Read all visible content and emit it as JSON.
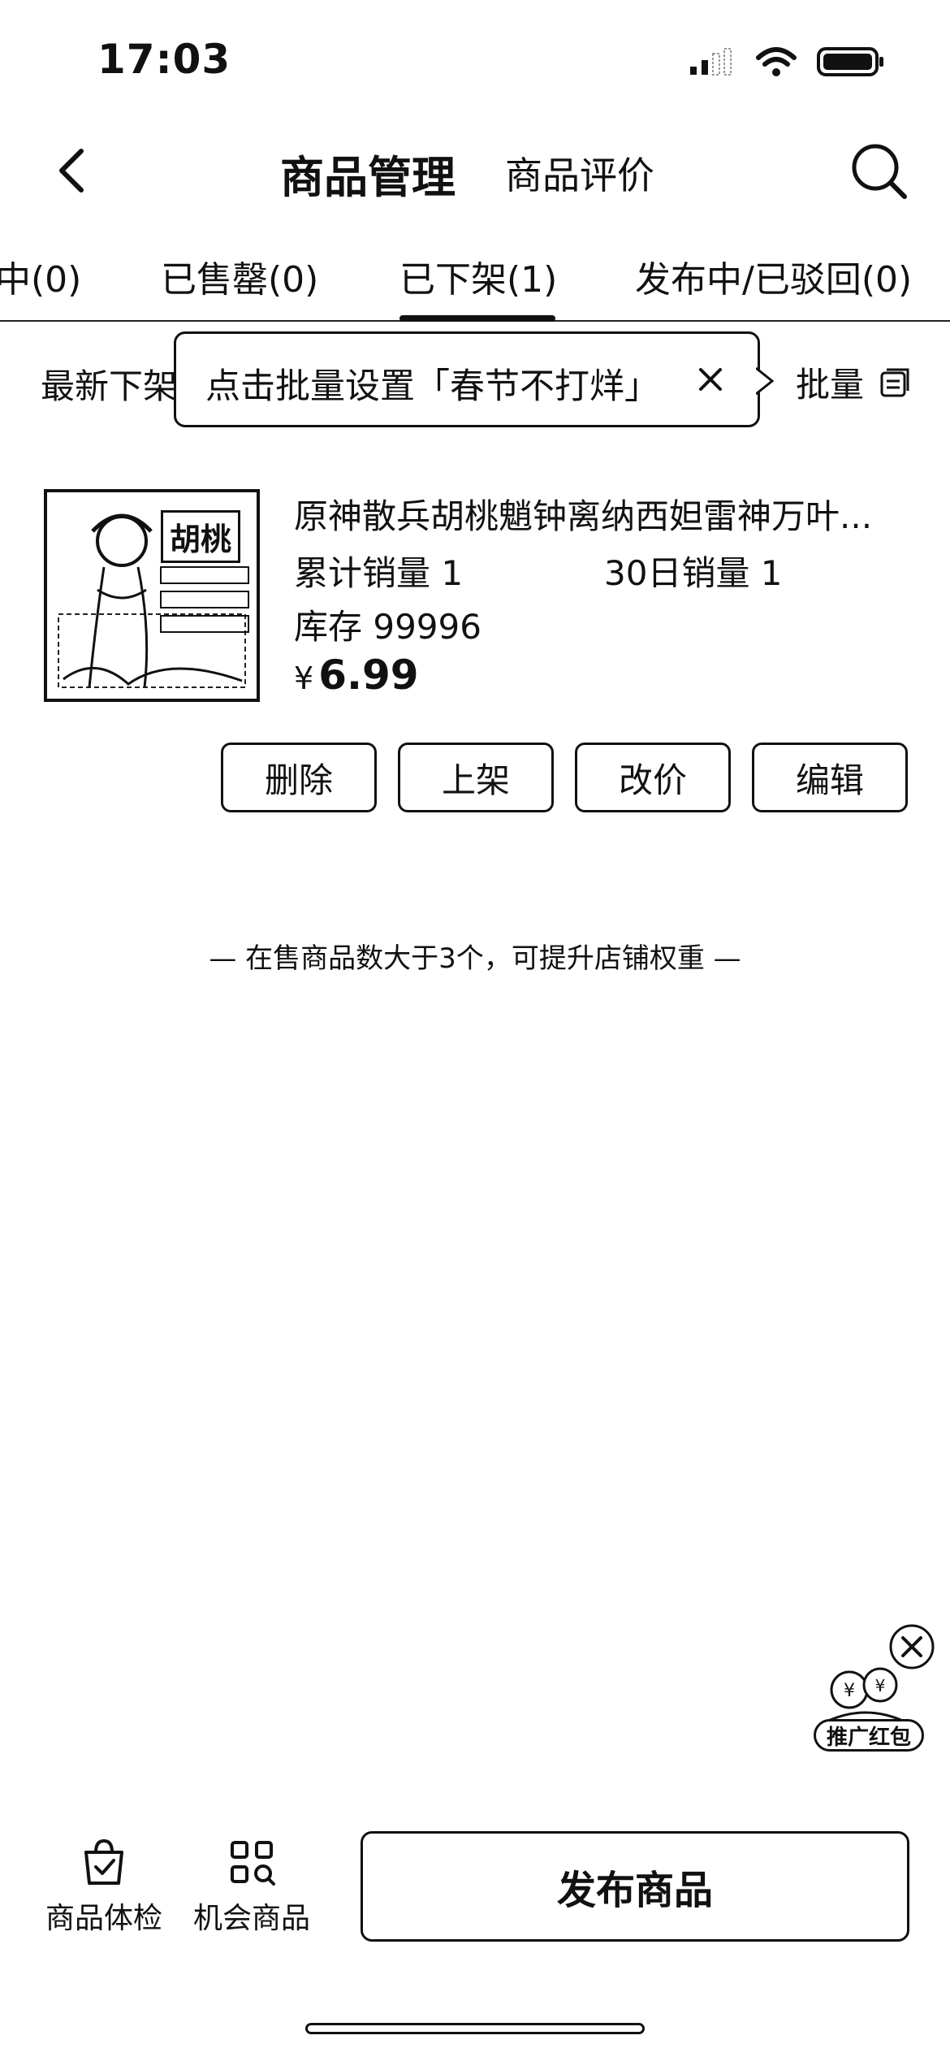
{
  "status_bar": {
    "time": "17:03"
  },
  "nav": {
    "title": "商品管理",
    "subtitle": "商品评价"
  },
  "tabs": [
    {
      "label": "中(0)"
    },
    {
      "label": "已售罄(0)"
    },
    {
      "label": "已下架(1)",
      "active": true
    },
    {
      "label": "发布中/已驳回(0)"
    }
  ],
  "filter": {
    "sort_label": "最新下架",
    "batch_label": "批量"
  },
  "tooltip": {
    "text": "点击批量设置「春节不打烊」"
  },
  "product": {
    "thumb_label": "胡桃",
    "title": "原神散兵胡桃魈钟离纳西妲雷神万叶...",
    "sales_total": "累计销量 1",
    "sales_30d": "30日销量 1",
    "stock": "库存 99996",
    "price_symbol": "¥",
    "price": "6.99",
    "actions": [
      "删除",
      "上架",
      "改价",
      "编辑"
    ]
  },
  "hint": "— 在售商品数大于3个，可提升店铺权重 —",
  "promo": {
    "label": "推广红包"
  },
  "bottom": {
    "health_check": "商品体检",
    "opportunity": "机会商品",
    "publish": "发布商品"
  }
}
